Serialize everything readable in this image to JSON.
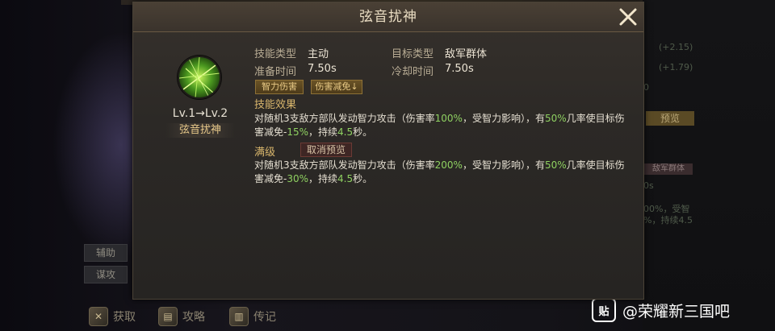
{
  "dialog": {
    "title": "弦音扰神",
    "close_icon": "close-x-icon"
  },
  "skill": {
    "icon": "green-light-beams-skill-icon",
    "level_text": "Lv.1→Lv.2",
    "name": "弦音扰神"
  },
  "info": {
    "skill_type_label": "技能类型",
    "skill_type_value": "主动",
    "target_type_label": "目标类型",
    "target_type_value": "敌军群体",
    "prep_time_label": "准备时间",
    "prep_time_value": "7.50s",
    "cooldown_label": "冷却时间",
    "cooldown_value": "7.50s",
    "tags": [
      "智力伤害",
      "伤害减免↓"
    ]
  },
  "effect": {
    "section_label": "技能效果",
    "desc_parts": [
      "对随机3支敌方部队发动智力攻击（伤害率",
      "100%",
      "，受智力影响），有",
      "50%",
      "几率使目标伤害减免-",
      "15%",
      "，持续",
      "4.5",
      "秒。"
    ]
  },
  "max_level": {
    "label": "满级",
    "cancel_preview_label": "取消预览",
    "desc_parts": [
      "对随机3支敌方部队发动智力攻击（伤害率",
      "200%",
      "，受智力影响），有",
      "50%",
      "几率使目标伤害减免-",
      "30%",
      "，持续",
      "4.5",
      "秒。"
    ]
  },
  "background": {
    "stat1": "(+2.15)",
    "stat2": "(+1.79)",
    "stat_zero": "0",
    "preview_btn": "预览",
    "target_tag": "敌军群体",
    "partial_s": "0s",
    "partial_text1": "00%，受智",
    "partial_text2": "%，持续4.5",
    "side_btn1": "辅助",
    "side_btn2": "谋攻",
    "bottom_btn1": "获取",
    "bottom_btn2": "攻略",
    "bottom_btn3": "传记"
  },
  "watermark": {
    "text": "@荣耀新三国吧",
    "icon_glyph": "贴"
  },
  "colors": {
    "highlight_green": "#8fd161",
    "section_gold": "#d9b66c",
    "name_gold": "#e8c98a"
  }
}
